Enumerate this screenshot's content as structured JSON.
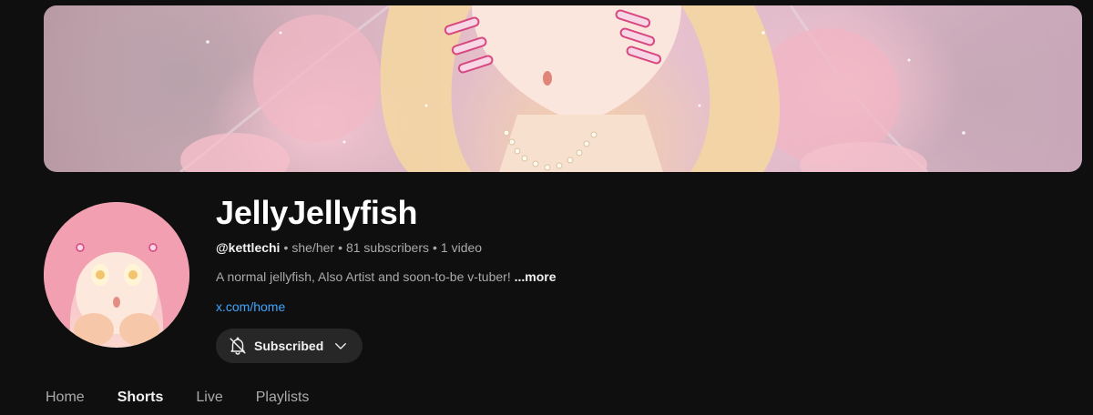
{
  "banner": {
    "alt": "channel-banner-artwork"
  },
  "avatar": {
    "alt": "channel-avatar-artwork"
  },
  "channel": {
    "name": "JellyJellyfish",
    "handle": "@kettlechi",
    "separator": "•",
    "pronouns": "she/her",
    "subscribers": "81 subscribers",
    "videos": "1 video",
    "description": "A normal jellyfish, Also Artist and soon-to-be v-tuber!",
    "more_label": "...more",
    "link": "x.com/home"
  },
  "subscribe": {
    "label": "Subscribed",
    "bell_icon": "bell-off-icon",
    "chevron_icon": "chevron-down-icon"
  },
  "tabs": [
    {
      "label": "Home",
      "active": false
    },
    {
      "label": "Shorts",
      "active": true
    },
    {
      "label": "Live",
      "active": false
    },
    {
      "label": "Playlists",
      "active": false
    }
  ],
  "colors": {
    "background": "#0f0f0f",
    "button_bg": "#272727",
    "link": "#3ea6ff",
    "secondary_text": "#aaaaaa",
    "primary_text": "#f1f1f1"
  }
}
